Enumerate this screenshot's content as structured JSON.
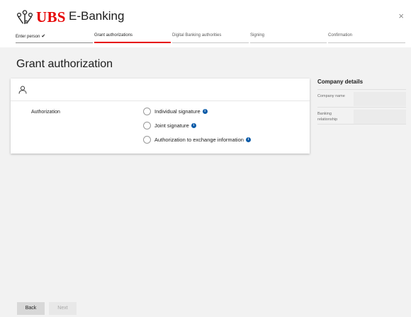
{
  "header": {
    "brand": "UBS",
    "app_title": "E-Banking",
    "close_symbol": "×"
  },
  "steps": [
    {
      "label": "Enter person",
      "state": "done"
    },
    {
      "label": "Grant authorizations",
      "state": "active"
    },
    {
      "label": "Digital Banking authorities",
      "state": "pending"
    },
    {
      "label": "Signing",
      "state": "pending"
    },
    {
      "label": "Confirmation",
      "state": "pending"
    }
  ],
  "page_title": "Grant authorization",
  "card": {
    "section_label": "Authorization",
    "options": [
      {
        "label": "Individual signature",
        "selected": false
      },
      {
        "label": "Joint signature",
        "selected": false
      },
      {
        "label": "Authorization to exchange information",
        "selected": false
      }
    ]
  },
  "company_details": {
    "title": "Company details",
    "rows": [
      {
        "label": "Company name",
        "value": ""
      },
      {
        "label": "Banking relationship",
        "value": ""
      }
    ]
  },
  "footer": {
    "back_label": "Back",
    "next_label": "Next"
  },
  "colors": {
    "brand_red": "#e60000",
    "info_blue": "#0a5ba8",
    "background": "#f2f2f2"
  }
}
